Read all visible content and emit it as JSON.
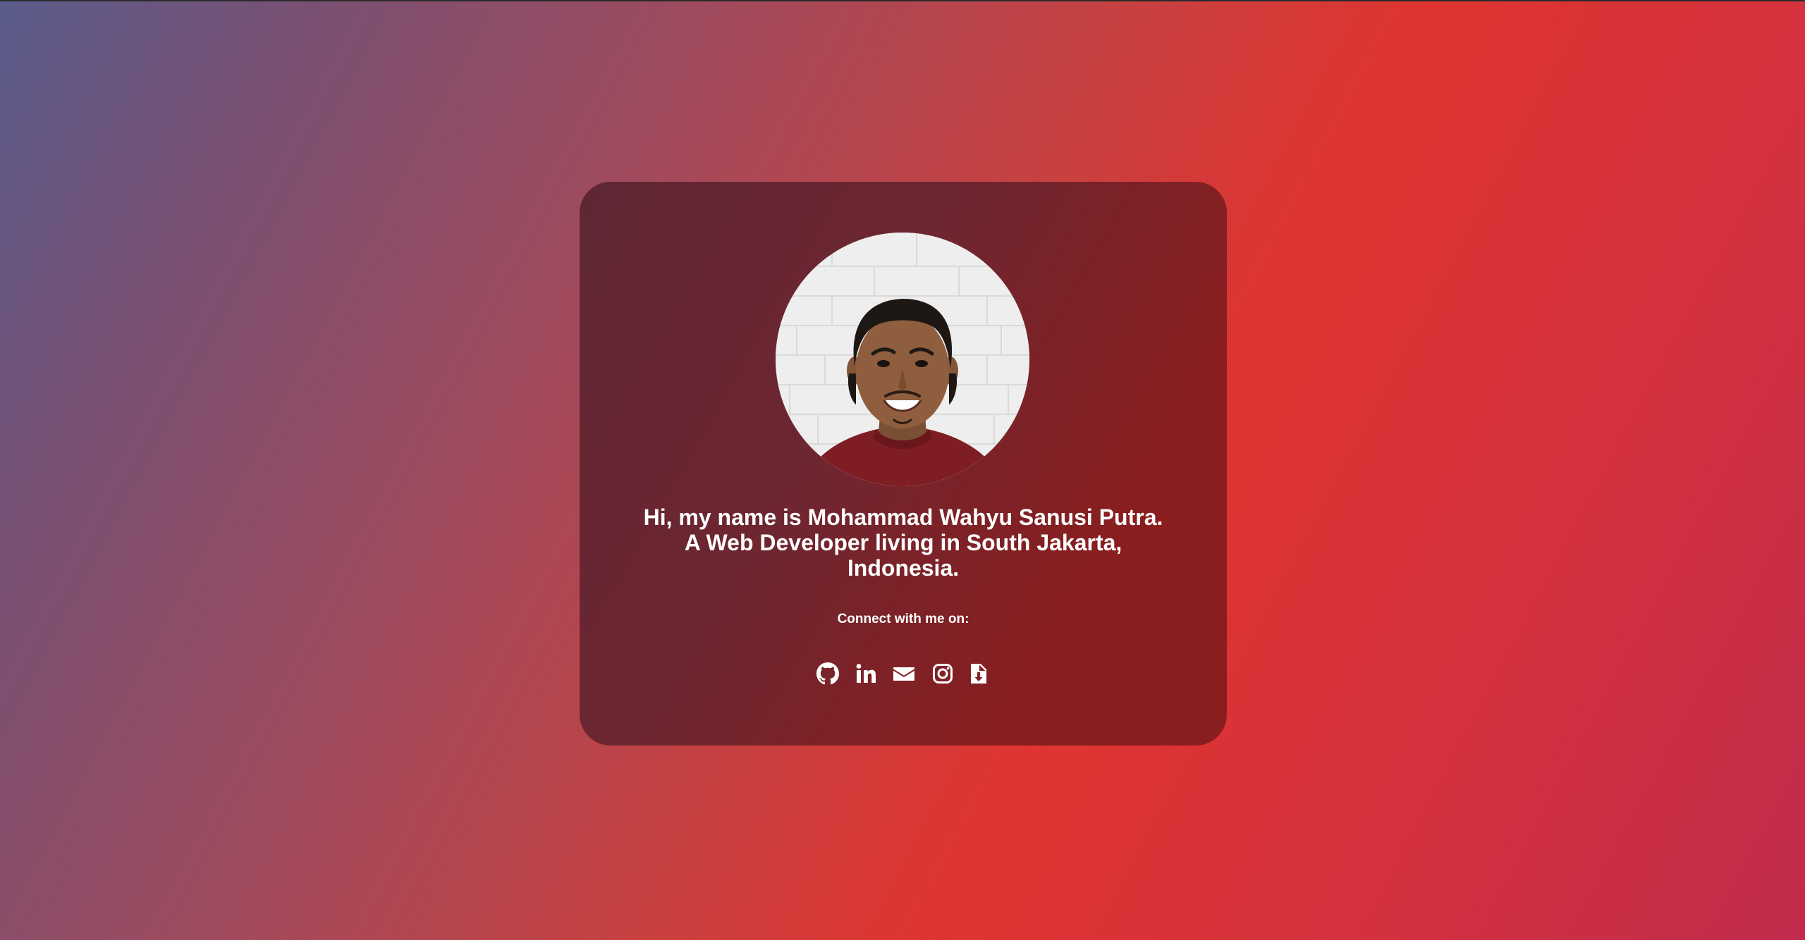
{
  "profile": {
    "intro_line_1": "Hi, my name is Mohammad Wahyu Sanusi Putra.",
    "intro_line_2": "A Web Developer living in South Jakarta,",
    "intro_line_3": "Indonesia.",
    "connect_label": "Connect with me on:"
  },
  "social": {
    "items": [
      {
        "icon": "github-icon"
      },
      {
        "icon": "linkedin-icon"
      },
      {
        "icon": "envelope-icon"
      },
      {
        "icon": "instagram-icon"
      },
      {
        "icon": "file-download-icon"
      }
    ]
  },
  "colors": {
    "card": "#7a2228",
    "text": "#ffffff",
    "shirt": "#7f1d24"
  }
}
